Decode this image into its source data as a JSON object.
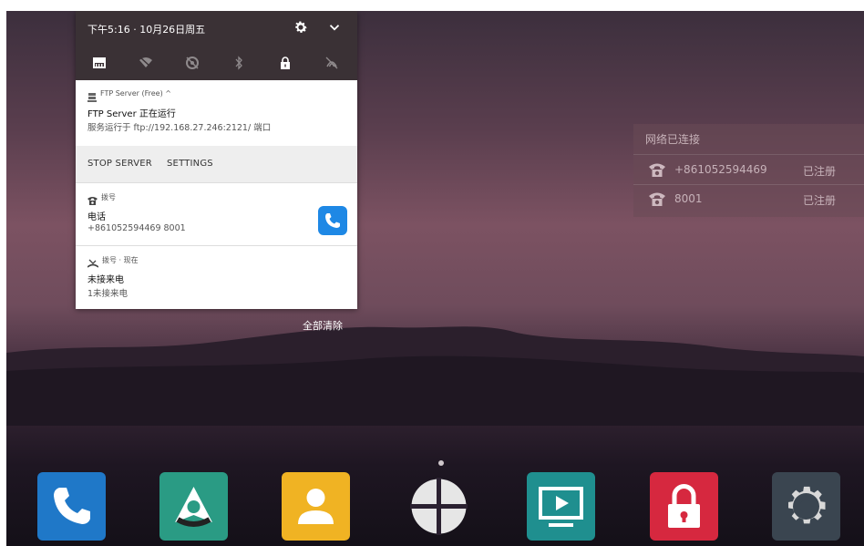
{
  "status_bar": {
    "time_date": "下午5:16 · 10月26日周五",
    "icons": [
      "settings-icon",
      "expand-chevron-icon"
    ]
  },
  "quick_settings": [
    {
      "name": "ethernet-icon"
    },
    {
      "name": "wifi-off-icon"
    },
    {
      "name": "location-off-icon"
    },
    {
      "name": "bluetooth-off-icon"
    },
    {
      "name": "lock-icon"
    },
    {
      "name": "nfc-off-icon"
    }
  ],
  "notifications": {
    "ftp": {
      "app_label": "FTP Server (Free) ^",
      "title": "FTP Server 正在运行",
      "body": "服务运行于 ftp://192.168.27.246:2121/ 端口",
      "actions": [
        "STOP SERVER",
        "SETTINGS"
      ]
    },
    "dial": {
      "app_label": "拨号",
      "title": "电话",
      "body": "+861052594469 8001"
    },
    "missed": {
      "app_label": "拨号 · 现在",
      "title": "未接来电",
      "body": "1未接来电"
    },
    "clear_all": "全部清除"
  },
  "network_widget": {
    "header": "网络已连接",
    "accounts": [
      {
        "number": "+861052594469",
        "status": "已注册"
      },
      {
        "number": "8001",
        "status": "已注册"
      }
    ]
  },
  "dock": [
    {
      "name": "phone-app-icon",
      "color": "#1f78c8"
    },
    {
      "name": "navigation-app-icon",
      "color": "#2a9b84"
    },
    {
      "name": "contacts-app-icon",
      "color": "#f0b323"
    },
    {
      "name": "apps-launcher-icon",
      "color": "#e0e0e0"
    },
    {
      "name": "screen-share-app-icon",
      "color": "#1f8f8f"
    },
    {
      "name": "lock-app-icon",
      "color": "#d6283f"
    },
    {
      "name": "settings-app-icon",
      "color": "#3a4550"
    }
  ],
  "colors": {
    "shade_header": "#3a3135",
    "accent_blue": "#1e88e5"
  }
}
